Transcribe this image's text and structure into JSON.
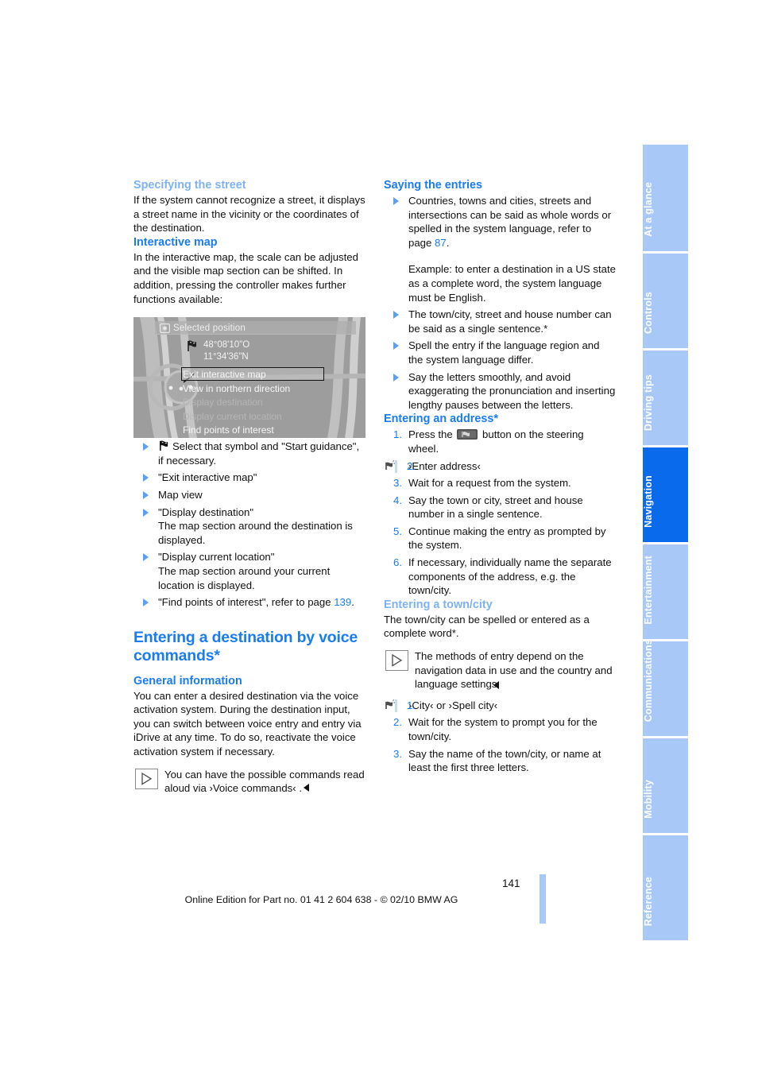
{
  "document": {
    "page_number": "141",
    "footer": "Online Edition for Part no. 01 41 2 604 638 - © 02/10 BMW AG"
  },
  "sidebar": {
    "tabs": [
      {
        "label": "At a glance",
        "active": false
      },
      {
        "label": "Controls",
        "active": false
      },
      {
        "label": "Driving tips",
        "active": false
      },
      {
        "label": "Navigation",
        "active": true
      },
      {
        "label": "Entertainment",
        "active": false
      },
      {
        "label": "Communications",
        "active": false
      },
      {
        "label": "Mobility",
        "active": false
      },
      {
        "label": "Reference",
        "active": false
      }
    ],
    "colors": {
      "inactive_bg": "#a8c9f7",
      "active_bg": "#0a6aec",
      "label": "#ffffff"
    }
  },
  "colors": {
    "heading_blue": "#1a7cf0",
    "heading_light_blue": "#7eb2f2",
    "bullet_blue": "#5aa1f2",
    "body_text": "#111111"
  },
  "left_column": {
    "specifying_street": {
      "heading": "Specifying the street",
      "body": "If the system cannot recognize a street, it displays a street name in the vicinity or the coordinates of the destination."
    },
    "interactive_map": {
      "heading": "Interactive map",
      "body": "In the interactive map, the scale can be adjusted and the visible map section can be shifted. In addition, pressing the controller makes further functions available:",
      "figure": {
        "title_bar": "Selected position",
        "coordinates": "48°08'10\"O\n11°34'36\"N",
        "menu_items": [
          {
            "label": "Exit interactive map",
            "selected": true,
            "dimmed": false
          },
          {
            "label": "View in northern direction",
            "selected": false,
            "dimmed": false
          },
          {
            "label": "Display destination",
            "selected": false,
            "dimmed": true
          },
          {
            "label": "Display current location",
            "selected": false,
            "dimmed": true
          },
          {
            "label": "Find points of interest",
            "selected": false,
            "dimmed": false
          }
        ]
      },
      "bullets": [
        {
          "icon": "destination-flag-icon",
          "text": "Select that symbol and \"Start guidance\", if necessary."
        },
        {
          "text": "\"Exit interactive map\""
        },
        {
          "text": "Map view"
        },
        {
          "text": "\"Display destination\"\nThe map section around the destination is displayed."
        },
        {
          "text": "\"Display current location\"\nThe map section around your current location is displayed."
        },
        {
          "text": "\"Find points of interest\", refer to page ",
          "page_ref": "139",
          "text_after": "."
        }
      ]
    },
    "voice_commands": {
      "heading": "Entering a destination by voice commands*",
      "general": {
        "heading": "General information",
        "body": "You can enter a desired destination via the voice activation system. During the destination input, you can switch between voice entry and entry via iDrive at any time. To do so, reactivate the voice activation system if necessary.",
        "note": "You can have the possible commands read aloud via ›Voice commands‹ ."
      }
    }
  },
  "right_column": {
    "saying_entries": {
      "heading": "Saying the entries",
      "bullets": [
        {
          "text": "Countries, towns and cities, streets and intersections can be said as whole words or spelled in the system language, refer to page ",
          "page_ref": "87",
          "text_after": ".",
          "sub": "Example: to enter a destination in a US state as a complete word, the system language must be English."
        },
        {
          "text": "The town/city, street and house number can be said as a single sentence.*"
        },
        {
          "text": "Spell the entry if the language region and the system language differ."
        },
        {
          "text": "Say the letters smoothly, and avoid exaggerating the pronunciation and inserting lengthy pauses between the letters."
        }
      ]
    },
    "entering_address": {
      "heading": "Entering an address*",
      "steps": [
        {
          "num": "1.",
          "text_before": "Press the ",
          "icon": "steering-wheel-button-icon",
          "text_after": " button on the steering wheel.",
          "voice": false
        },
        {
          "num": "2.",
          "text": "›Enter address‹",
          "voice": true
        },
        {
          "num": "3.",
          "text": "Wait for a request from the system.",
          "voice": false
        },
        {
          "num": "4.",
          "text": "Say the town or city, street and house number in a single sentence.",
          "voice": false
        },
        {
          "num": "5.",
          "text": "Continue making the entry as prompted by the system.",
          "voice": false
        },
        {
          "num": "6.",
          "text": "If necessary, individually name the separate components of the address, e.g. the town/city.",
          "voice": false
        }
      ]
    },
    "entering_town": {
      "heading": "Entering a town/city",
      "body": "The town/city can be spelled or entered as a complete word*.",
      "note": "The methods of entry depend on the navigation data in use and the country and language settings.",
      "steps": [
        {
          "num": "1.",
          "text": "›City‹ or ›Spell city‹",
          "voice": true
        },
        {
          "num": "2.",
          "text": "Wait for the system to prompt you for the town/city.",
          "voice": false
        },
        {
          "num": "3.",
          "text": "Say the name of the town/city, or name at least the first three letters.",
          "voice": false
        }
      ]
    }
  }
}
